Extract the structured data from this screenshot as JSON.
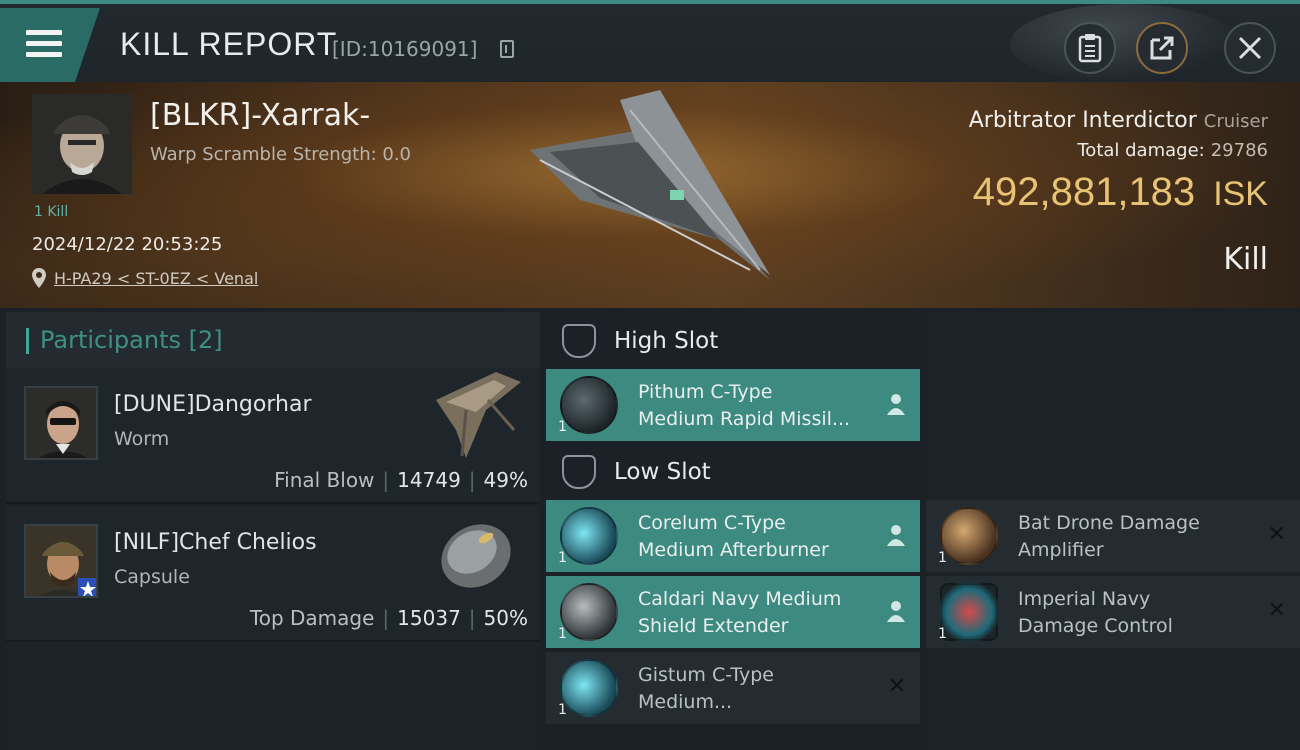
{
  "header": {
    "title": "KILL REPORT",
    "report_id": "[ID:10169091]"
  },
  "icons": {
    "menu": "hamburger-menu-icon",
    "copy": "copy-icon",
    "clipboard": "clipboard-icon",
    "share": "share-icon",
    "close": "close-icon",
    "location": "location-pin-icon",
    "slot": "slot-shield-icon",
    "assigned": "person-icon",
    "destroyed": "x-mark-icon"
  },
  "victim": {
    "name": "[BLKR]-Xarrak-",
    "warp_scramble": "Warp Scramble Strength: 0.0",
    "kills": "1 Kill",
    "timestamp": "2024/12/22 20:53:25",
    "location": "H-PA29 < ST-0EZ < Venal",
    "ship_name": "Arbitrator Interdictor",
    "ship_class": "Cruiser",
    "total_damage_label": "Total damage:",
    "total_damage_value": "29786",
    "isk_value": "492,881,183",
    "isk_unit": "ISK",
    "result": "Kill"
  },
  "participants": {
    "header": "Participants [2]",
    "items": [
      {
        "name": "[DUNE]Dangorhar",
        "ship": "Worm",
        "role": "Final Blow",
        "damage": "14749",
        "percent": "49%"
      },
      {
        "name": "[NILF]Chef Chelios",
        "ship": "Capsule",
        "role": "Top Damage",
        "damage": "15037",
        "percent": "50%"
      }
    ]
  },
  "slots": {
    "high": {
      "title": "High Slot",
      "modules": [
        {
          "name_line1": "Pithum C-Type",
          "name_line2": "Medium Rapid Missil...",
          "qty": "1"
        }
      ]
    },
    "low": {
      "title": "Low Slot",
      "modules": [
        {
          "name_line1": "Corelum C-Type",
          "name_line2": "Medium Afterburner",
          "qty": "1"
        },
        {
          "name_line1": "Bat Drone Damage",
          "name_line2": "Amplifier",
          "qty": "1"
        },
        {
          "name_line1": "Caldari Navy Medium",
          "name_line2": "Shield Extender",
          "qty": "1"
        },
        {
          "name_line1": "Imperial Navy",
          "name_line2": "Damage Control",
          "qty": "1"
        },
        {
          "name_line1": "Gistum C-Type",
          "name_line2": "Medium...",
          "qty": "1"
        }
      ]
    }
  },
  "colors": {
    "accent_teal": "#3c8a80",
    "isk_gold": "#e8c373",
    "background": "#1b2126"
  }
}
